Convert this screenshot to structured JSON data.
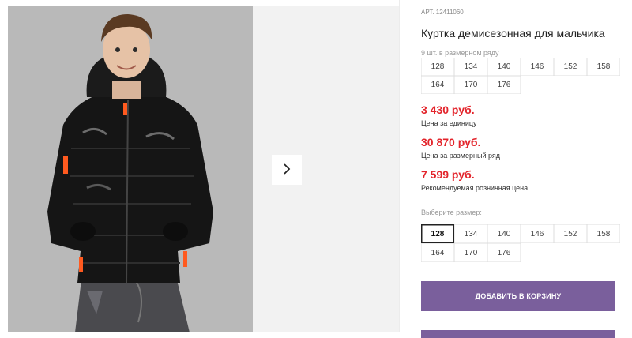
{
  "product": {
    "sku": "АРТ. 12411060",
    "title": "Куртка демисезонная для мальчика",
    "pack_caption": "9 шт. в размерном ряду",
    "pack_sizes": [
      "128",
      "134",
      "140",
      "146",
      "152",
      "158",
      "164",
      "170",
      "176"
    ]
  },
  "prices": {
    "unit": {
      "value": "3 430 руб.",
      "label": "Цена за единицу"
    },
    "pack": {
      "value": "30 870 руб.",
      "label": "Цена за размерный ряд"
    },
    "retail": {
      "value": "7 599 руб.",
      "label": "Рекомендуемая розничная цена"
    }
  },
  "size_select": {
    "label": "Выберите размер:",
    "options": [
      "128",
      "134",
      "140",
      "146",
      "152",
      "158",
      "164",
      "170",
      "176"
    ],
    "selected": "128"
  },
  "actions": {
    "add_to_cart": "ДОБАВИТЬ В КОРЗИНУ"
  },
  "gallery": {
    "next_icon": "chevron-right-icon"
  },
  "colors": {
    "price": "#e3242b",
    "button": "#7a5f9c",
    "photo_bg": "#b9b9b9"
  }
}
